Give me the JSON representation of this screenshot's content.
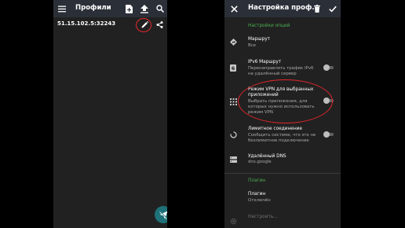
{
  "left_screen": {
    "title": "Профили",
    "profile": {
      "address": "51.15.102.5:32243"
    },
    "icons": {
      "menu": "menu-icon",
      "add_file": "add-file-icon",
      "upload": "upload-icon",
      "search": "search-icon",
      "edit": "pencil-icon",
      "share": "share-icon",
      "connect": "paper-plane-icon"
    },
    "highlight_color": "#e3262a",
    "fab_color": "#1e7178"
  },
  "right_screen": {
    "title": "Настройка проф...",
    "icons": {
      "close": "close-icon",
      "delete": "trash-icon",
      "save": "check-icon"
    },
    "sections": {
      "routing": "Настройки опций",
      "plugin": "Плагин"
    },
    "settings": {
      "route": {
        "title": "Маршрут",
        "summary": "Все"
      },
      "ipv6": {
        "title": "IPv6 Маршрут",
        "summary_line1": "Перенаправлять трафик IPv6",
        "summary_line2": "на удалённый сервер",
        "enabled": false
      },
      "per_app": {
        "title_line1": "Режим VPN для выбранных",
        "title_line2": "приложений",
        "summary_line1": "Выбрать приложения, для",
        "summary_line2": "которых нужно использовать",
        "summary_line3": "режим VPN",
        "enabled": false
      },
      "metered": {
        "title": "Лимитное соединение",
        "summary_line1": "Сообщить системе, что это не",
        "summary_line2": "безлимитное подключение",
        "enabled": false
      },
      "remote_dns": {
        "title": "Удалённый DNS",
        "summary": "dns.google"
      },
      "plugin": {
        "title": "Плагин",
        "summary": "Отключён"
      },
      "plugin_config": {
        "title": "Настроить...",
        "summary": ""
      }
    },
    "accent_color": "#4caf50",
    "highlight_color": "#e3262a"
  }
}
